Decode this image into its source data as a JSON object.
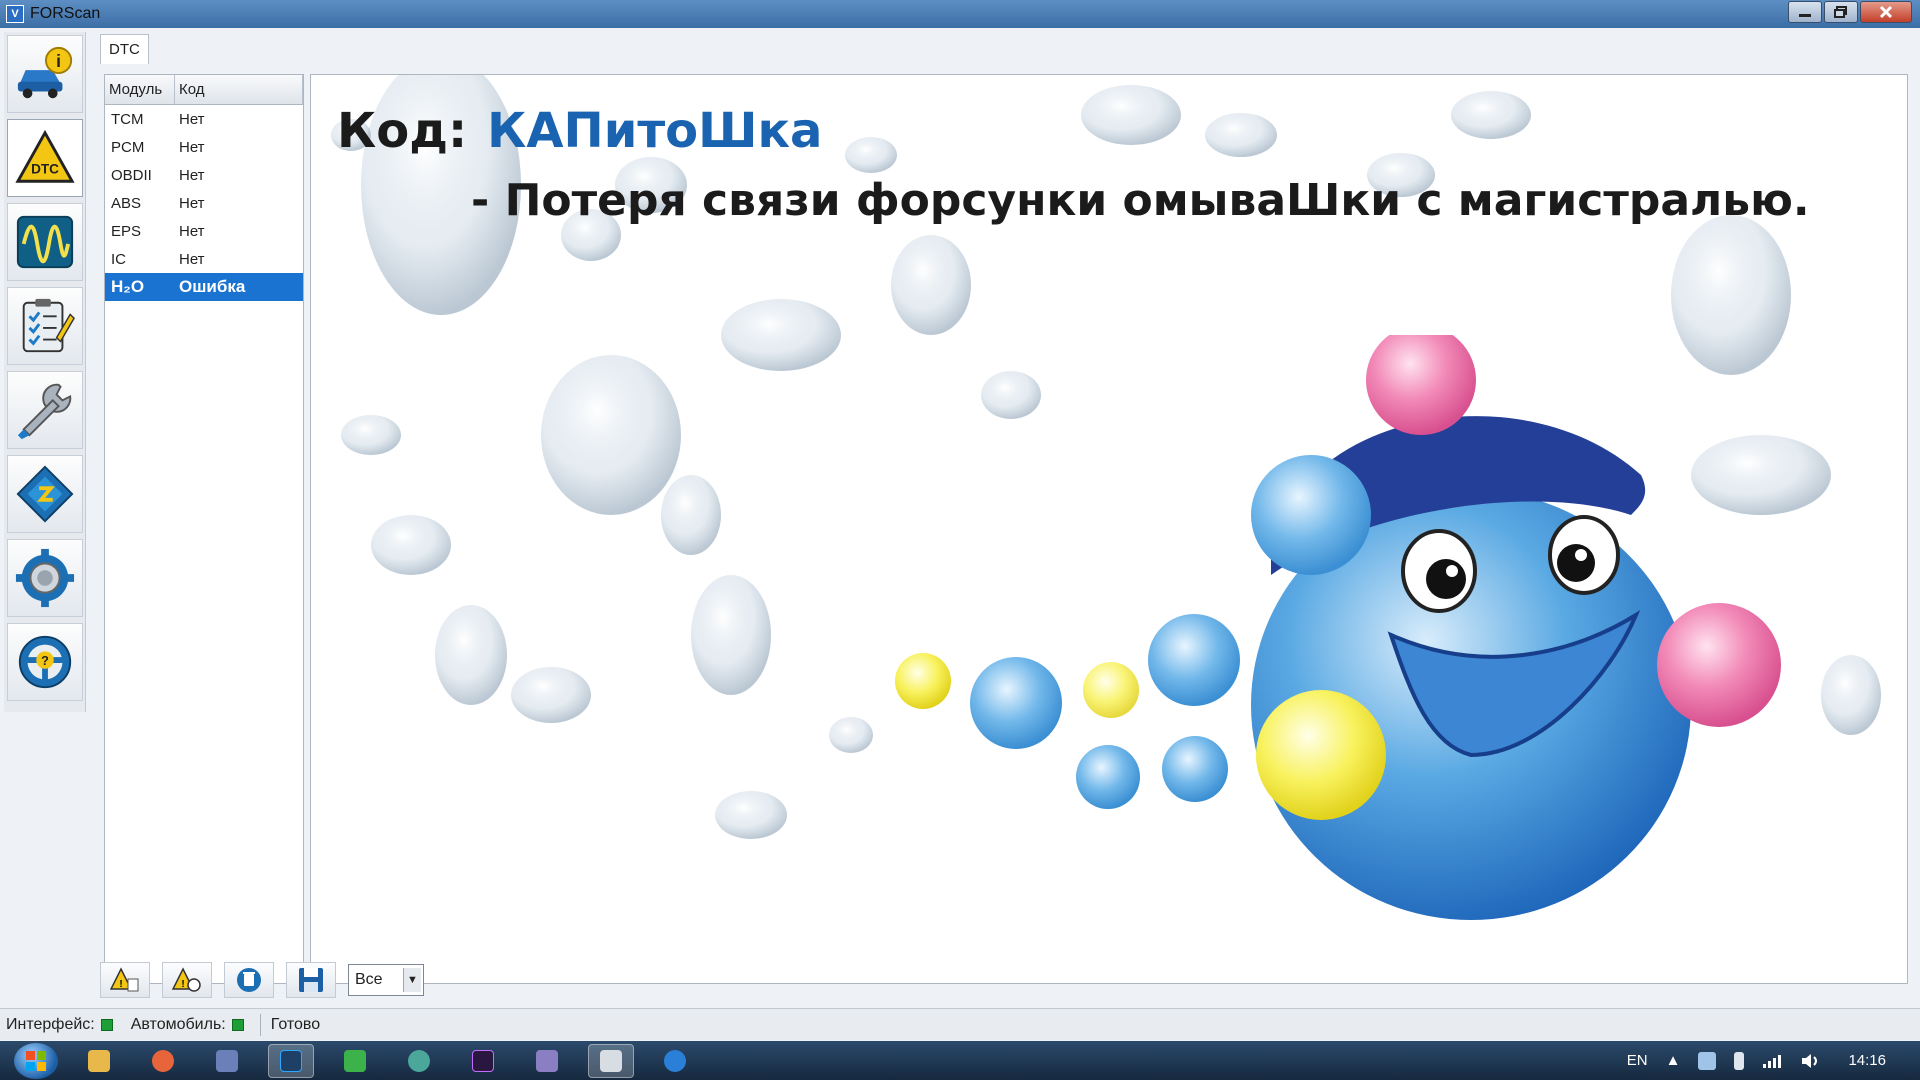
{
  "window": {
    "title": "FORScan",
    "app_icon_letter": "V"
  },
  "tabs": [
    {
      "label": "DTC"
    }
  ],
  "dtc_table": {
    "headers": [
      "Модуль",
      "Код"
    ],
    "rows": [
      {
        "module": "TCM",
        "code": "Нет"
      },
      {
        "module": "PCM",
        "code": "Нет"
      },
      {
        "module": "OBDII",
        "code": "Нет"
      },
      {
        "module": "ABS",
        "code": "Нет"
      },
      {
        "module": "EPS",
        "code": "Нет"
      },
      {
        "module": "IC",
        "code": "Нет"
      },
      {
        "module": "H₂O",
        "code": "Ошибка"
      }
    ],
    "selected_index": 6
  },
  "content": {
    "code_label": "Код:",
    "code_value": "КАПитоШка",
    "description": "- Потеря связи форсунки омываШки с магистралью."
  },
  "bottom_toolbar": {
    "filter_value": "Все"
  },
  "statusbar": {
    "interface_label": "Интерфейс:",
    "vehicle_label": "Автомобиль:",
    "status_text": "Готово"
  },
  "taskbar": {
    "language": "EN",
    "time": "14:16"
  },
  "colors": {
    "selection": "#1a73d1",
    "code_value": "#1a63b0",
    "led_ok": "#1e9e36"
  },
  "icons": {
    "left_toolbar": [
      "vehicle-info-icon",
      "dtc-icon",
      "oscilloscope-icon",
      "checklist-icon",
      "wrench-icon",
      "module-config-icon",
      "settings-gear-icon",
      "help-wheel-icon"
    ],
    "bottom_toolbar": [
      "read-dtc-icon",
      "clear-dtc-icon",
      "delete-icon",
      "save-icon"
    ]
  }
}
